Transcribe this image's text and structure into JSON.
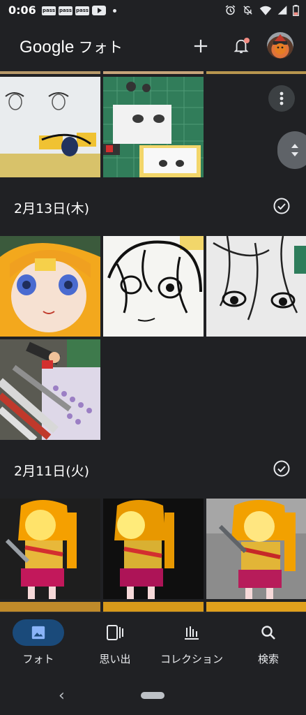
{
  "status_bar": {
    "time": "0:06",
    "pass_icons": [
      "pass",
      "pass",
      "pass"
    ],
    "icons": [
      "alarm-icon",
      "mute-icon",
      "wifi-icon",
      "signal-icon",
      "battery-icon"
    ]
  },
  "app_bar": {
    "title_brand": "Google",
    "title_suffix": "フォト",
    "add_icon": "plus-icon",
    "notification_icon": "bell-icon",
    "notification_dot_color": "#f28b82"
  },
  "sections": [
    {
      "date": "2月13日(木)"
    },
    {
      "date": "2月11日(火)"
    }
  ],
  "bottom_nav": {
    "active_color": "#1a4a7a",
    "items": [
      {
        "label": "フォト",
        "icon": "photo-icon",
        "active": true
      },
      {
        "label": "思い出",
        "icon": "memories-icon",
        "active": false
      },
      {
        "label": "コレクション",
        "icon": "collections-icon",
        "active": false
      },
      {
        "label": "検索",
        "icon": "search-icon",
        "active": false
      }
    ]
  }
}
